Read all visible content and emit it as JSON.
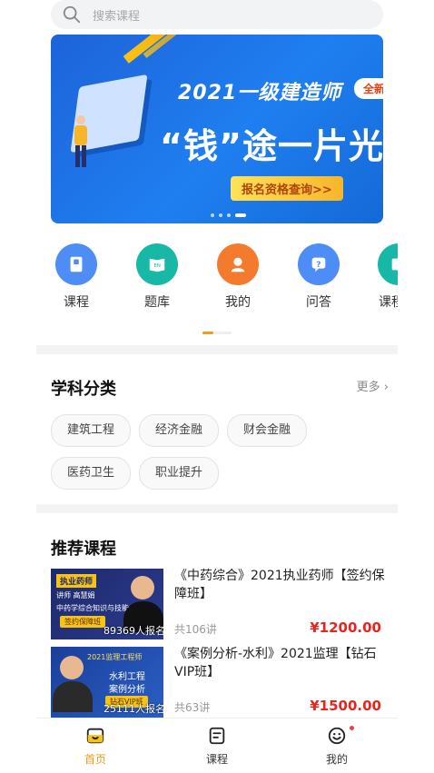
{
  "search": {
    "placeholder": "搜索课程"
  },
  "banner": {
    "title_line1": "2021一级建造师",
    "tag": "全新课程",
    "title_line2": "“钱”途一片光明",
    "cta": "报名资格查询>>",
    "active_dot": 4,
    "dot_count": 4
  },
  "quick_nav": [
    {
      "label": "课程",
      "icon": "book-icon",
      "color": "#4d8df5"
    },
    {
      "label": "题库",
      "icon": "en-book-icon",
      "color": "#18b8a6"
    },
    {
      "label": "我的",
      "icon": "user-icon",
      "color": "#f47b2d"
    },
    {
      "label": "问答",
      "icon": "question-icon",
      "color": "#4d8df5"
    },
    {
      "label": "课程",
      "icon": "play-icon",
      "color": "#18b8a6"
    }
  ],
  "subjects": {
    "title": "学科分类",
    "more": "更多 ›",
    "chips": [
      "建筑工程",
      "经济金融",
      "财会金融",
      "医药卫生",
      "职业提升"
    ]
  },
  "recommend": {
    "title": "推荐课程",
    "courses": [
      {
        "title": "《中药综合》2021执业药师【签约保障班】",
        "lessons": "共106讲",
        "price": "¥1200.00",
        "enrolled": "89369人报名",
        "thumb_tag": "执业药师",
        "thumb_line1": "讲师 高慧娟",
        "thumb_line2": "中药学综合知识与技能",
        "thumb_btn": "签约保障班"
      },
      {
        "title": "《案例分析-水利》2021监理【钻石VIP班】",
        "lessons": "共63讲",
        "price": "¥1500.00",
        "enrolled": "25111人报名",
        "thumb_tag": "2021监理工程师",
        "thumb_line1": "水利工程",
        "thumb_line2": "案例分析",
        "thumb_btn": "钻石VIP班"
      }
    ]
  },
  "tabbar": [
    {
      "label": "首页",
      "icon": "home-icon",
      "active": true
    },
    {
      "label": "课程",
      "icon": "course-icon",
      "active": false
    },
    {
      "label": "我的",
      "icon": "smile-icon",
      "active": false,
      "badge": true
    }
  ],
  "colors": {
    "accent": "#f09b16",
    "price": "#e8241f",
    "banner_blue": "#1f7ff0"
  }
}
